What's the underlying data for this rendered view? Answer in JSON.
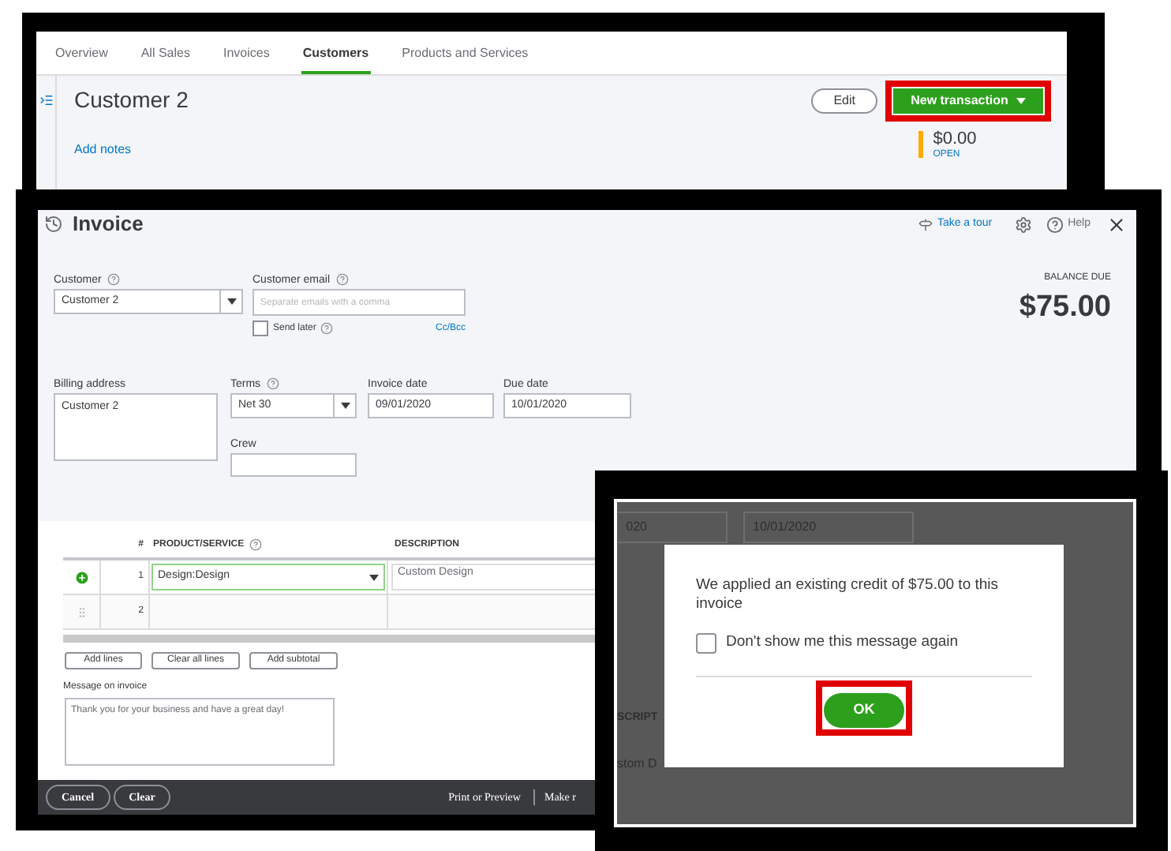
{
  "customer_page": {
    "tabs": [
      {
        "label": "Overview",
        "selected": false
      },
      {
        "label": "All Sales",
        "selected": false
      },
      {
        "label": "Invoices",
        "selected": false
      },
      {
        "label": "Customers",
        "selected": true
      },
      {
        "label": "Products and Services",
        "selected": false
      }
    ],
    "customer_name": "Customer 2",
    "edit_button": "Edit",
    "new_transaction_button": {
      "label": "New transaction",
      "highlighted": true
    },
    "add_notes": "Add notes",
    "open_balance": {
      "amount": "$0.00",
      "label": "OPEN"
    }
  },
  "invoice": {
    "title": "Invoice",
    "tour_link": "Take a tour",
    "help": "Help",
    "balance_label": "BALANCE DUE",
    "balance": "$75.00",
    "customer": {
      "label": "Customer",
      "value": "Customer 2"
    },
    "customer_email": {
      "label": "Customer email",
      "placeholder": "Separate emails with a comma"
    },
    "send_later": {
      "label": "Send later",
      "checked": false
    },
    "cc_bcc": "Cc/Bcc",
    "billing_address": {
      "label": "Billing address",
      "value": "Customer 2"
    },
    "terms": {
      "label": "Terms",
      "value": "Net 30"
    },
    "invoice_date": {
      "label": "Invoice date",
      "value": "09/01/2020"
    },
    "due_date": {
      "label": "Due date",
      "value": "10/01/2020"
    },
    "crew": {
      "label": "Crew"
    },
    "table": {
      "columns": [
        "#",
        "PRODUCT/SERVICE",
        "DESCRIPTION"
      ],
      "rows": [
        {
          "number": "1",
          "product": "Design:Design",
          "description": "Custom Design",
          "active": true
        },
        {
          "number": "2",
          "active": false
        }
      ]
    },
    "line_buttons": [
      "Add lines",
      "Clear all lines",
      "Add subtotal"
    ],
    "message": {
      "label": "Message on invoice",
      "value": "Thank you for your business and have a great day!"
    },
    "footer": {
      "left": [
        "Cancel",
        "Clear"
      ],
      "right": [
        "Print or Preview",
        "Make r"
      ]
    }
  },
  "credit_dialog": {
    "background": {
      "field_1": "020",
      "field_2": "10/01/2020",
      "column": "SCRIPT",
      "cell": "stom D"
    },
    "message": "We applied an existing credit of $75.00 to this invoice",
    "dont_show": {
      "label": "Don't show me this message again",
      "checked": false
    },
    "ok_button": {
      "label": "OK",
      "highlighted": true
    }
  }
}
